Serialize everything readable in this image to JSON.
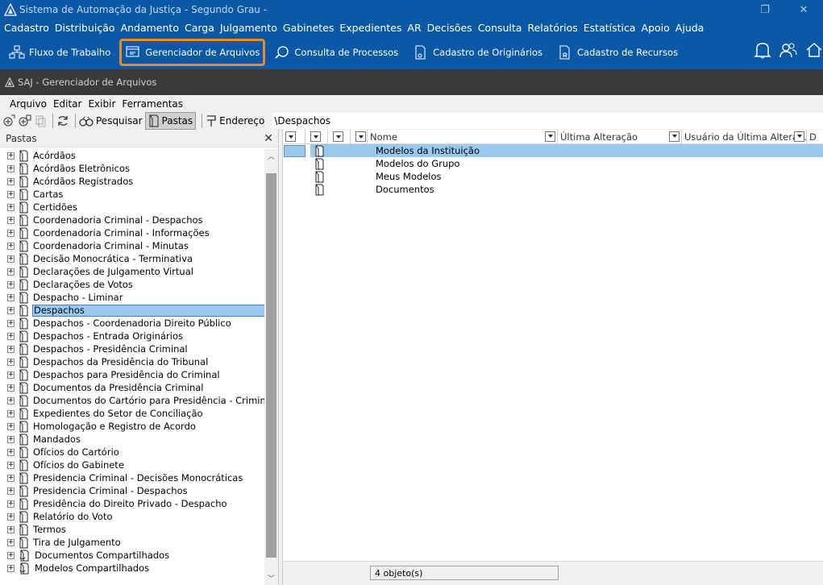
{
  "titlebar": {
    "title": "Sistema de Automação da Justiça - Segundo Grau -"
  },
  "menu": [
    "Cadastro",
    "Distribuição",
    "Andamento",
    "Carga",
    "Julgamento",
    "Gabinetes",
    "Expedientes",
    "AR",
    "Decisões",
    "Consulta",
    "Relatórios",
    "Estatística",
    "Apoio",
    "Ajuda"
  ],
  "toolbar": {
    "fluxo": "Fluxo de Trabalho",
    "gerenciador": "Gerenciador de Arquivos",
    "consulta": "Consulta de Processos",
    "originarios": "Cadastro de Originários",
    "recursos": "Cadastro de Recursos"
  },
  "window": {
    "title": "SAJ - Gerenciador de Arquivos"
  },
  "menu2": {
    "arquivo": "Arquivo",
    "editar": "Editar",
    "exibir": "Exibir",
    "ferramentas": "Ferramentas"
  },
  "toolbar2": {
    "pesquisar": "Pesquisar",
    "pastas": "Pastas",
    "endereco": "Endereço",
    "address_value": "\\Despachos"
  },
  "left_panel": {
    "title": "Pastas"
  },
  "tree": [
    "Acórdãos",
    "Acórdãos Eletrônicos",
    "Acórdãos Registrados",
    "Cartas",
    "Certidões",
    "Coordenadoria Criminal - Despachos",
    "Coordenadoria Criminal - Informações",
    "Coordenadoria Criminal - Minutas",
    "Decisão Monocrática - Terminativa",
    "Declarações de Julgamento Virtual",
    "Declarações de Votos",
    "Despacho - Liminar",
    "Despachos",
    "Despachos - Coordenadoria Direito Público",
    "Despachos - Entrada Originários",
    "Despachos - Presidência Criminal",
    "Despachos da Presidência do Tribunal",
    "Despachos para Presidência do Criminal",
    "Documentos da Presidência Criminal",
    "Documentos do Cartório para Presidência - Criminal",
    "Expedientes do Setor de Conciliação",
    "Homologação e Registro de Acordo",
    "Mandados",
    "Ofícios do Cartório",
    "Ofícios do Gabinete",
    "Presidencia Criminal - Decisões Monocráticas",
    "Presidencia Criminal - Despachos",
    "Presidência do Direito Privado - Despacho",
    "Relatório do Voto",
    "Termos",
    "Tira de Julgamento",
    "Documentos Compartilhados",
    "Modelos Compartilhados"
  ],
  "tree_selected_index": 12,
  "columns": {
    "nome": "Nome",
    "ultima": "Última Alteração",
    "usuario": "Usuário da Última Altera...",
    "d": "D"
  },
  "files": [
    "Modelos da Instituição",
    "Modelos do Grupo",
    "Meus Modelos",
    "Documentos"
  ],
  "status": {
    "count": "4 objeto(s)"
  },
  "colors": {
    "titlebar": "#0b58a7",
    "highlight": "#e98a2a",
    "selection": "#99c9ef"
  }
}
